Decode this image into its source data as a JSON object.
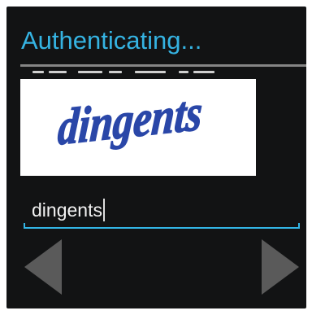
{
  "dialog": {
    "title": "Authenticating..."
  },
  "captcha": {
    "word": "dingents",
    "ink_color": "#2a47a8"
  },
  "answer": {
    "value": "dingents"
  },
  "navigation": {
    "prev_icon": "triangle-left-icon",
    "next_icon": "triangle-right-icon",
    "color": "#5a5a5a"
  },
  "colors": {
    "accent": "#33b5e5",
    "background": "#121314"
  }
}
